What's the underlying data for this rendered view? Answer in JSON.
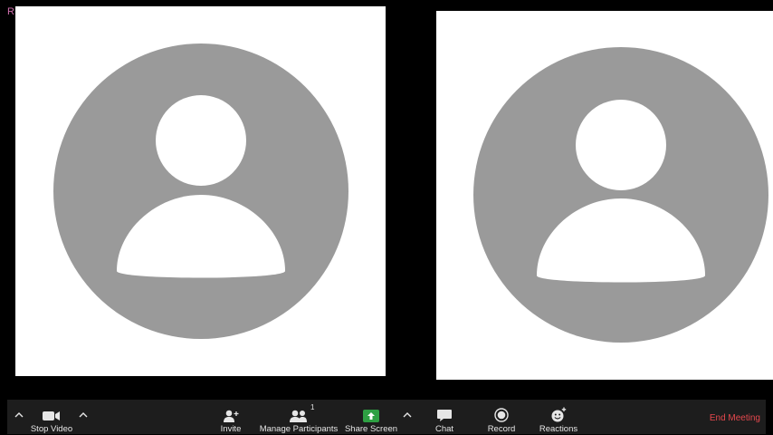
{
  "watermark": "REDGIFS",
  "participants": [
    {
      "avatar": "default-avatar"
    },
    {
      "avatar": "default-avatar"
    }
  ],
  "toolbar": {
    "stop_video": "Stop Video",
    "invite": "Invite",
    "manage_participants": "Manage Participants",
    "participant_count": "1",
    "share_screen": "Share Screen",
    "chat": "Chat",
    "record": "Record",
    "reactions": "Reactions",
    "end_meeting": "End Meeting"
  },
  "colors": {
    "background": "#000000",
    "tile_background": "#ffffff",
    "avatar_gray": "#9a9a9a",
    "toolbar_background": "#1d1d1d",
    "share_screen_green": "#2ea043",
    "end_meeting_red": "#e5484d",
    "watermark_pink": "#d06fae"
  }
}
